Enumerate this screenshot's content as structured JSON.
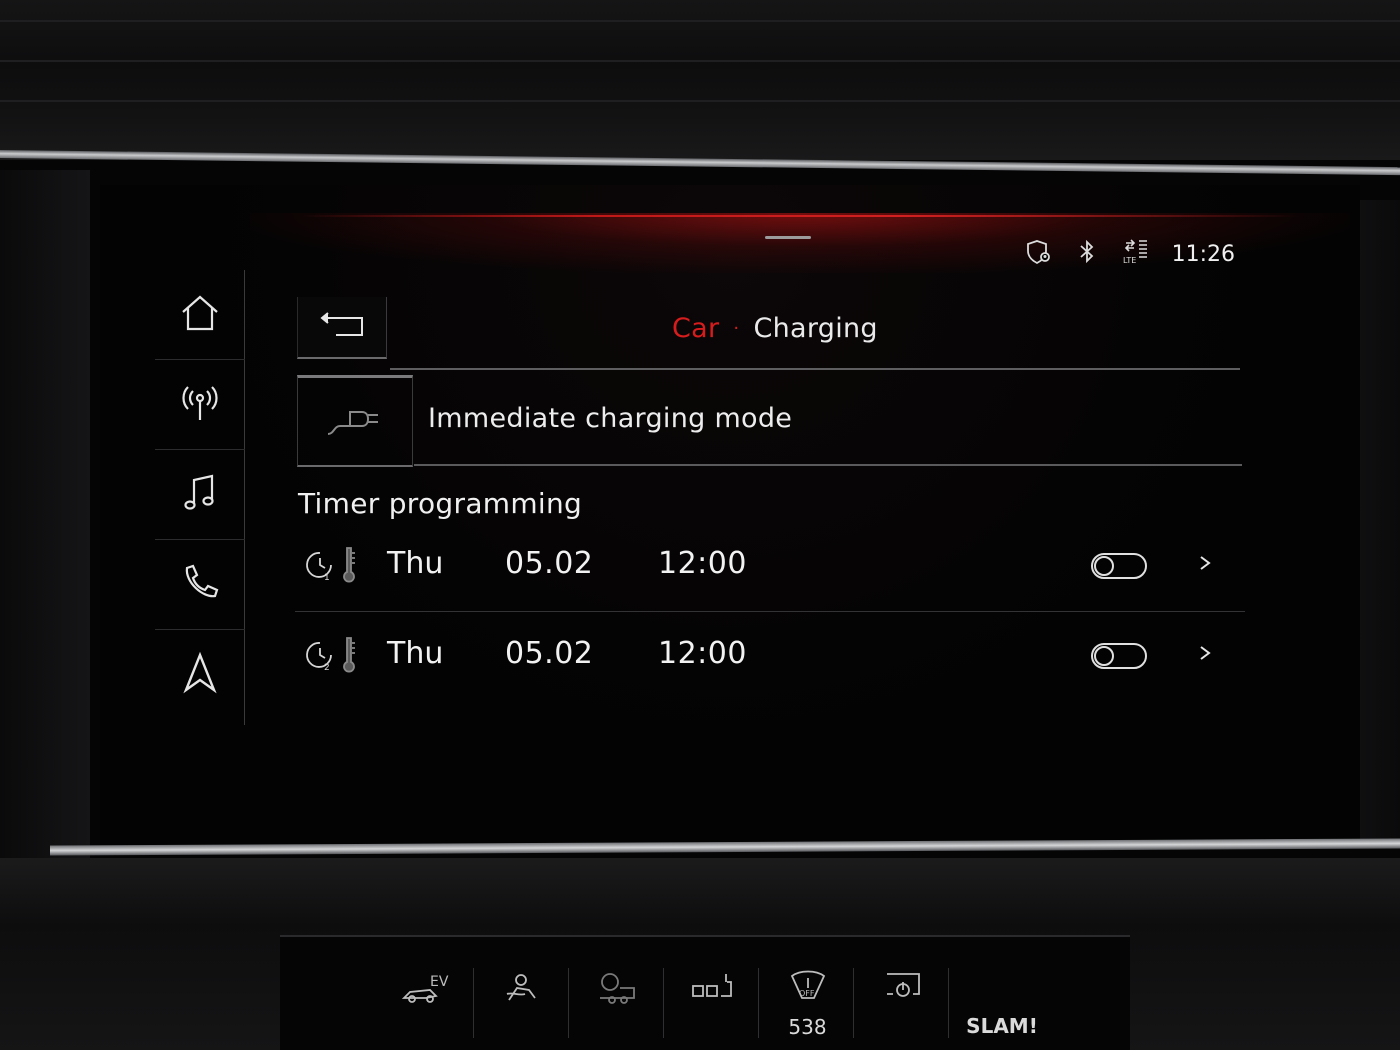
{
  "status_bar": {
    "time": "11:26",
    "icons": [
      "shield-location-icon",
      "bluetooth-icon",
      "lte-signal-icon"
    ]
  },
  "nav": [
    {
      "name": "home",
      "icon": "home-icon"
    },
    {
      "name": "radio",
      "icon": "radio-antenna-icon"
    },
    {
      "name": "media",
      "icon": "music-note-icon"
    },
    {
      "name": "phone",
      "icon": "phone-icon"
    },
    {
      "name": "navigation",
      "icon": "navigation-arrow-icon"
    }
  ],
  "header": {
    "back_icon": "back-arrow-icon",
    "breadcrumb_parent": "Car",
    "breadcrumb_separator": "·",
    "breadcrumb_current": "Charging"
  },
  "immediate_charging": {
    "icon": "charging-plug-icon",
    "label": "Immediate charging mode"
  },
  "timer_section": {
    "title": "Timer programming",
    "timers": [
      {
        "index": "1",
        "day": "Thu",
        "date": "05.02",
        "time": "12:00",
        "enabled": false
      },
      {
        "index": "2",
        "day": "Thu",
        "date": "05.02",
        "time": "12:00",
        "enabled": false
      }
    ]
  },
  "lower_panel": {
    "items": [
      {
        "icon": "ev-mode-icon",
        "value": ""
      },
      {
        "icon": "climate-icon",
        "value": ""
      },
      {
        "icon": "trailer-icon",
        "value": ""
      },
      {
        "icon": "parking-icon",
        "value": ""
      },
      {
        "icon": "esc-off-icon",
        "value": "538"
      },
      {
        "icon": "power-icon",
        "value": "SLAM!"
      }
    ]
  },
  "colors": {
    "accent_red": "#d61c1c",
    "text": "#eaeaea",
    "background": "#030303"
  }
}
